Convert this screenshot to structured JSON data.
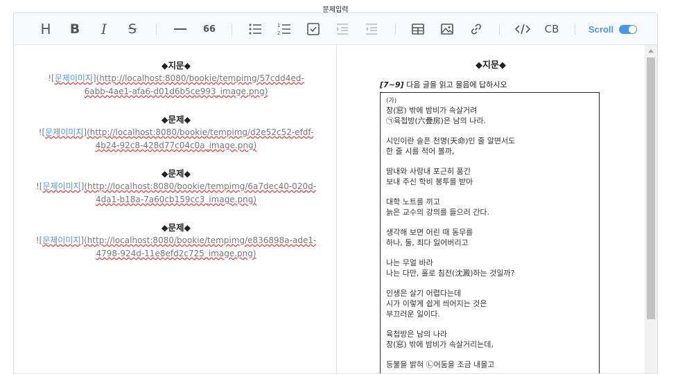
{
  "page": {
    "title": "문제입력"
  },
  "toolbar": {
    "heading": "H",
    "bold": "B",
    "italic": "I",
    "strike": "S",
    "quote": "66",
    "codeblock": "CB",
    "scroll_label": "Scroll",
    "scroll_enabled": true,
    "icons": [
      "heading-icon",
      "bold-icon",
      "italic-icon",
      "strike-icon",
      "hr-icon",
      "quote-icon",
      "bullet-list-icon",
      "ordered-list-icon",
      "task-list-icon",
      "indent-icon",
      "outdent-icon",
      "table-icon",
      "image-icon",
      "link-icon",
      "code-icon",
      "codeblock-icon"
    ]
  },
  "markdown": {
    "blocks": [
      {
        "heading": "◆지문◆",
        "alt": "문제이미지",
        "line1": "(http://localhost:8080/bookie/tempimg/57cdd4ed-",
        "line2": "6abb-4ae1-afa6-d01d6b5ce993_image.png)"
      },
      {
        "heading": "◆문제◆",
        "alt": "문제이미지",
        "line1": "(http://localhost:8080/bookie/tempimg/d2e52c52-efdf-",
        "line2": "4b24-92c8-428d77c04c0a_image.png)"
      },
      {
        "heading": "◆문제◆",
        "alt": "문제이미지",
        "line1": "(http://localhost:8080/bookie/tempimg/6a7dec40-020d-",
        "line2": "4da1-b18a-7a60cb159cc3_image.png)"
      },
      {
        "heading": "◆문제◆",
        "alt": "문제이미지",
        "line1": "(http://localhost:8080/bookie/tempimg/e836898a-ade1-",
        "line2": "4798-924d-11e8efd2c725_image.png)"
      }
    ]
  },
  "preview": {
    "heading": "◆지문◆",
    "instruction_range": "[7~9]",
    "instruction_text": "다음 글을 읽고 물음에 답하시오",
    "poem_label": "(가)",
    "stanzas": [
      "창(窓) 밖에 밤비가 속살거려\n㉠육첩방(六疊房)은 남의 나라.",
      "시인이란 슬픈 천명(天命)인 줄 알면서도\n한 줄 시를 적어 볼까,",
      "땀내와 사랑내 포근히 품긴\n보내 주신 학비 봉투를 받아",
      "대학 노트를 끼고\n늙은 교수의 강의를 들으러 간다.",
      "생각해 보면 어린 때 동무를\n하나, 둘, 죄다 잃어버리고",
      "나는 무얼 바라\n나는 다만, 홀로 침전(沈澱)하는 것일까?",
      "인생은 살기 어렵다는데\n시가 이렇게 쉽게 씌어지는 것은\n부끄러운 일이다.",
      "육첩방은 남의 나라\n창(窓) 밖에 밤비가 속살거리는데,",
      "등불을 밝혀 ㉡어둠을 조금 내몰고"
    ]
  },
  "colors": {
    "accent": "#4b96e6",
    "toolbar_bg": "#f7f9fc",
    "border": "#dadde6"
  }
}
